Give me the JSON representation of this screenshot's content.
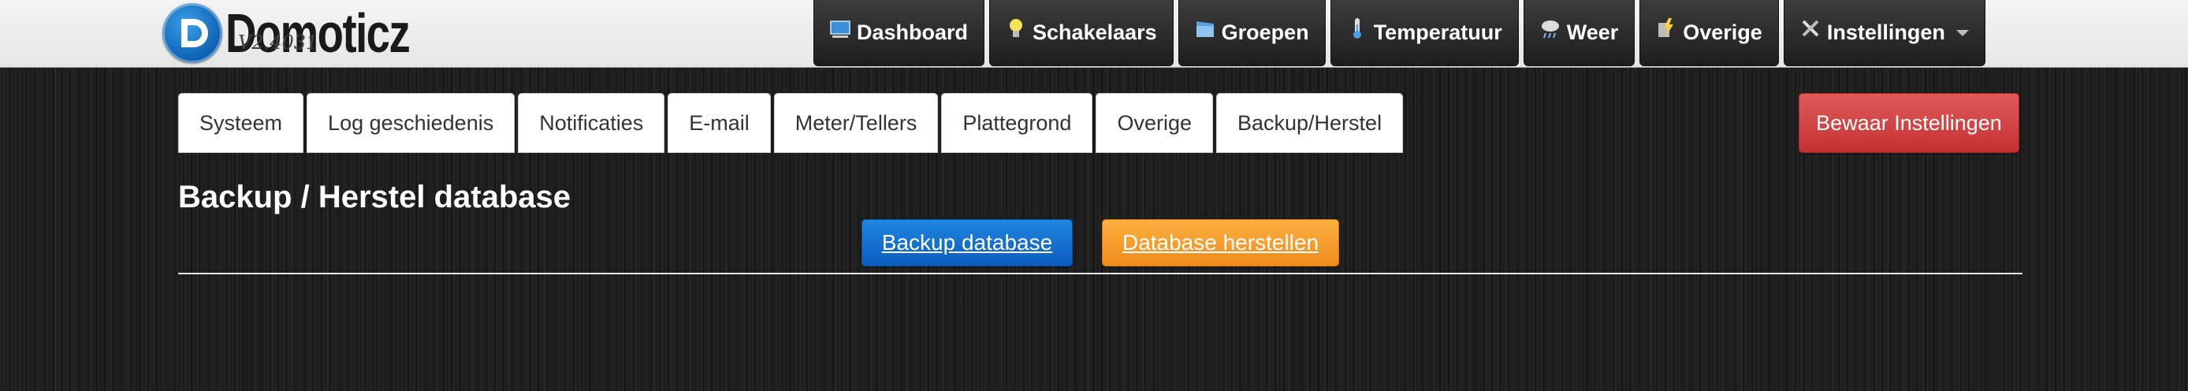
{
  "app": {
    "name": "Domoticz",
    "version": "V2.4031"
  },
  "topnav": {
    "items": [
      {
        "label": "Dashboard",
        "icon": "dashboard-icon"
      },
      {
        "label": "Schakelaars",
        "icon": "lightbulb-icon"
      },
      {
        "label": "Groepen",
        "icon": "clapperboard-icon"
      },
      {
        "label": "Temperatuur",
        "icon": "thermometer-icon"
      },
      {
        "label": "Weer",
        "icon": "rain-cloud-icon"
      },
      {
        "label": "Overige",
        "icon": "utility-icon"
      },
      {
        "label": "Instellingen",
        "icon": "tools-icon"
      }
    ]
  },
  "settings": {
    "tabs": [
      {
        "label": "Systeem"
      },
      {
        "label": "Log geschiedenis"
      },
      {
        "label": "Notificaties"
      },
      {
        "label": "E-mail"
      },
      {
        "label": "Meter/Tellers"
      },
      {
        "label": "Plattegrond"
      },
      {
        "label": "Overige"
      },
      {
        "label": "Backup/Herstel"
      }
    ],
    "save_label": "Bewaar Instellingen"
  },
  "content": {
    "title": "Backup / Herstel database",
    "backup_label": "Backup database",
    "restore_label": "Database herstellen"
  },
  "colors": {
    "save": "#c43232",
    "backup": "#0b5cbf",
    "restore": "#f08c1c"
  }
}
